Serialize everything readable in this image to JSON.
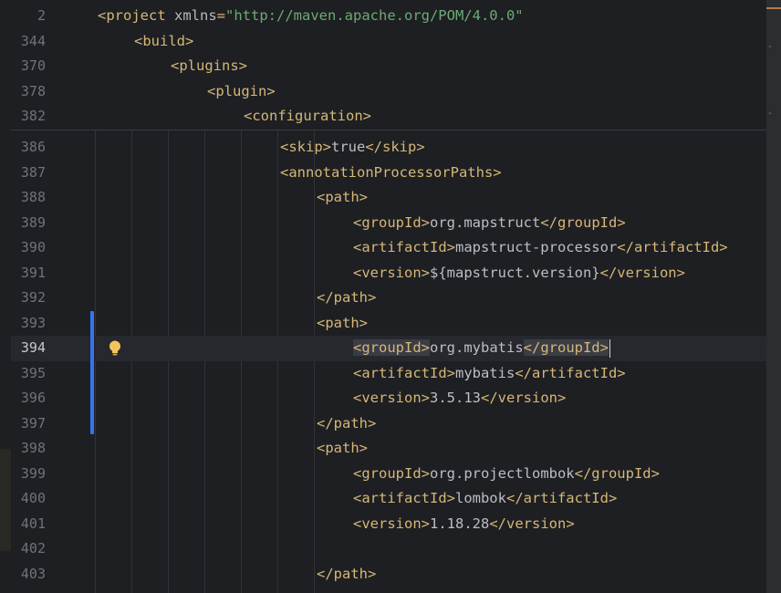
{
  "sticky_lines": [
    {
      "num": "2",
      "indent": 0,
      "parts": [
        [
          "tag",
          "<project "
        ],
        [
          "attr",
          "xmlns"
        ],
        [
          "tag",
          "="
        ],
        [
          "str",
          "\"http://maven.apache.org/POM/4.0.0\""
        ]
      ]
    },
    {
      "num": "344",
      "indent": 1,
      "parts": [
        [
          "tag",
          "<build>"
        ]
      ]
    },
    {
      "num": "370",
      "indent": 2,
      "parts": [
        [
          "tag",
          "<plugins>"
        ]
      ]
    },
    {
      "num": "378",
      "indent": 3,
      "parts": [
        [
          "tag",
          "<plugin>"
        ]
      ]
    },
    {
      "num": "382",
      "indent": 4,
      "parts": [
        [
          "tag",
          "<configuration>"
        ]
      ]
    }
  ],
  "lines": [
    {
      "num": "386",
      "indent": 5,
      "parts": [
        [
          "tag",
          "<skip>"
        ],
        [
          "txt",
          "true"
        ],
        [
          "tag",
          "</skip>"
        ]
      ]
    },
    {
      "num": "387",
      "indent": 5,
      "parts": [
        [
          "tag",
          "<annotationProcessorPaths>"
        ]
      ]
    },
    {
      "num": "388",
      "indent": 6,
      "parts": [
        [
          "tag",
          "<path>"
        ]
      ]
    },
    {
      "num": "389",
      "indent": 7,
      "parts": [
        [
          "tag",
          "<groupId>"
        ],
        [
          "txt",
          "org.mapstruct"
        ],
        [
          "tag",
          "</groupId>"
        ]
      ]
    },
    {
      "num": "390",
      "indent": 7,
      "parts": [
        [
          "tag",
          "<artifactId>"
        ],
        [
          "txt",
          "mapstruct-processor"
        ],
        [
          "tag",
          "</artifactId>"
        ]
      ]
    },
    {
      "num": "391",
      "indent": 7,
      "parts": [
        [
          "tag",
          "<version>"
        ],
        [
          "txt",
          "${mapstruct.version}"
        ],
        [
          "tag",
          "</version>"
        ]
      ]
    },
    {
      "num": "392",
      "indent": 6,
      "parts": [
        [
          "tag",
          "</path>"
        ]
      ]
    },
    {
      "num": "393",
      "indent": 6,
      "parts": [
        [
          "tag",
          "<path>"
        ]
      ]
    },
    {
      "num": "394",
      "indent": 7,
      "current": true,
      "parts": [
        [
          "tag-match",
          "<groupId>"
        ],
        [
          "txt",
          "org.mybatis"
        ],
        [
          "tag-match",
          "</groupId>"
        ],
        [
          "caret",
          ""
        ]
      ]
    },
    {
      "num": "395",
      "indent": 7,
      "parts": [
        [
          "tag",
          "<artifactId>"
        ],
        [
          "txt",
          "mybatis"
        ],
        [
          "tag",
          "</artifactId>"
        ]
      ]
    },
    {
      "num": "396",
      "indent": 7,
      "parts": [
        [
          "tag",
          "<version>"
        ],
        [
          "txt",
          "3.5.13"
        ],
        [
          "tag",
          "</version>"
        ]
      ]
    },
    {
      "num": "397",
      "indent": 6,
      "parts": [
        [
          "tag",
          "</path>"
        ]
      ]
    },
    {
      "num": "398",
      "indent": 6,
      "parts": [
        [
          "tag",
          "<path>"
        ]
      ]
    },
    {
      "num": "399",
      "indent": 7,
      "parts": [
        [
          "tag",
          "<groupId>"
        ],
        [
          "txt",
          "org.projectlombok"
        ],
        [
          "tag",
          "</groupId>"
        ]
      ]
    },
    {
      "num": "400",
      "indent": 7,
      "parts": [
        [
          "tag",
          "<artifactId>"
        ],
        [
          "txt",
          "lombok"
        ],
        [
          "tag",
          "</artifactId>"
        ]
      ]
    },
    {
      "num": "401",
      "indent": 7,
      "parts": [
        [
          "tag",
          "<version>"
        ],
        [
          "txt",
          "1.18.28"
        ],
        [
          "tag",
          "</version>"
        ]
      ]
    },
    {
      "num": "402",
      "indent": 0,
      "parts": []
    },
    {
      "num": "403",
      "indent": 6,
      "parts": [
        [
          "tag",
          "</path>"
        ]
      ]
    }
  ],
  "gutter": {
    "intention_icon": "lightbulb-icon",
    "change_marker_color": "#3574f0"
  },
  "colors": {
    "background": "#1e1f22",
    "tag": "#d5b778",
    "string": "#6aab73",
    "text": "#bcbec4",
    "line_number": "#6f737a"
  }
}
